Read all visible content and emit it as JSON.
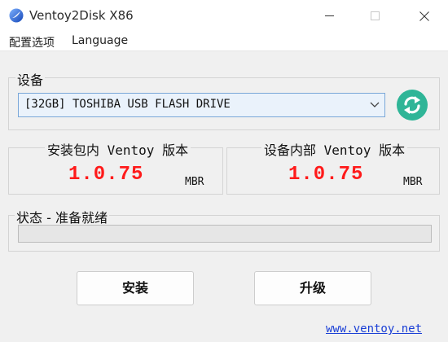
{
  "window": {
    "title": "Ventoy2Disk  X86",
    "icon": "ventoy-logo-icon",
    "controls": [
      "minimize-icon",
      "maximize-icon",
      "close-icon"
    ]
  },
  "menu": {
    "options": "配置选项",
    "language": "Language"
  },
  "device": {
    "group_label": "设备",
    "selected": "[32GB] TOSHIBA USB FLASH DRIVE",
    "refresh_icon": "refresh-icon"
  },
  "package_version": {
    "label": "安装包内 Ventoy 版本",
    "version": "1.0.75",
    "partition_style": "MBR"
  },
  "device_version": {
    "label": "设备内部 Ventoy 版本",
    "version": "1.0.75",
    "partition_style": "MBR"
  },
  "status": {
    "label": "状态 - 准备就绪",
    "progress_percent": 0
  },
  "buttons": {
    "install": "安装",
    "update": "升级"
  },
  "footer": {
    "website": "www.ventoy.net"
  },
  "colors": {
    "version_red": "#ff1a1a",
    "refresh_green": "#2fb597",
    "link_blue": "#1a3fd6"
  }
}
